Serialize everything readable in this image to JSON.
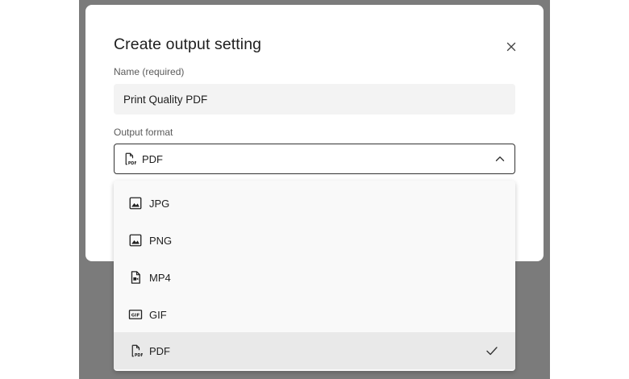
{
  "dialog": {
    "title": "Create output setting",
    "name_label": "Name (required)",
    "name_value": "Print Quality PDF",
    "format_label": "Output format",
    "selected_format": "PDF"
  },
  "menu": {
    "items": [
      {
        "label": "JPG",
        "icon": "image-icon"
      },
      {
        "label": "PNG",
        "icon": "image-icon"
      },
      {
        "label": "MP4",
        "icon": "video-file-icon"
      },
      {
        "label": "GIF",
        "icon": "gif-icon"
      },
      {
        "label": "PDF",
        "icon": "pdf-file-icon",
        "selected": true
      }
    ]
  },
  "colors": {
    "overlay": "#7b7b7b",
    "dialog_bg": "#ffffff",
    "field_bg": "#f3f3f3",
    "selected_item_bg": "#e9e9e9"
  }
}
